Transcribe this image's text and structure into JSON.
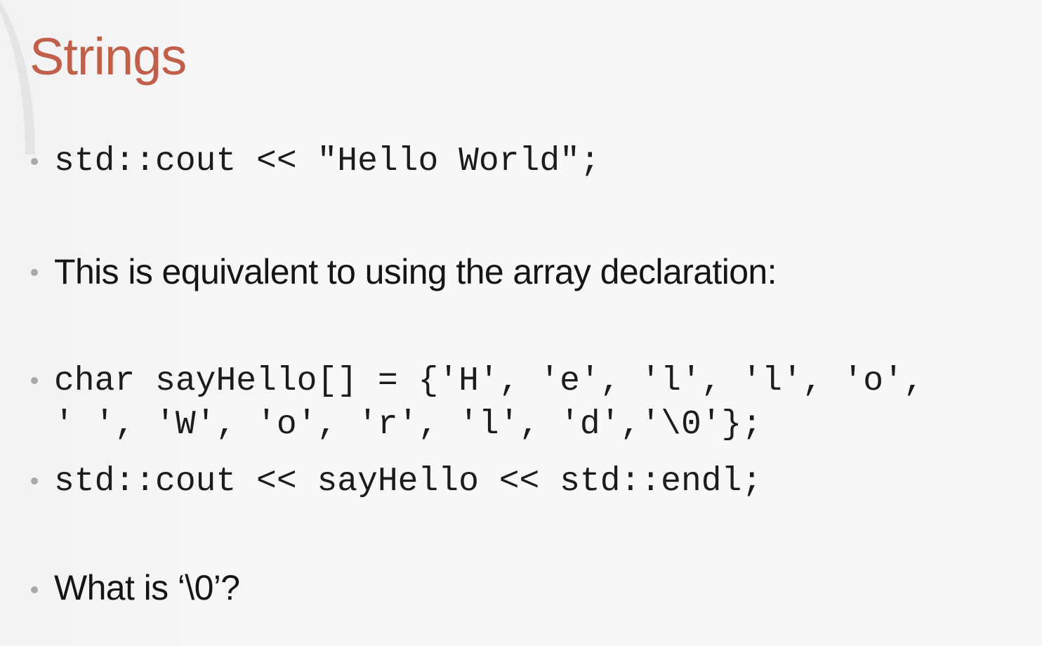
{
  "slide": {
    "title": "Strings",
    "bullets": [
      {
        "kind": "code",
        "lines": [
          "std::cout << \"Hello World\";"
        ]
      },
      {
        "kind": "text",
        "lines": [
          "This is equivalent to using the array declaration:"
        ]
      },
      {
        "kind": "code",
        "lines": [
          "char sayHello[] = {'H', 'e', 'l', 'l', 'o',",
          "' ', 'W', 'o', 'r', 'l', 'd','\\0'};"
        ]
      },
      {
        "kind": "code",
        "lines": [
          "std::cout << sayHello << std::endl;"
        ]
      },
      {
        "kind": "text",
        "lines": [
          "What is ‘\\0’?"
        ]
      }
    ]
  },
  "colors": {
    "title": "#c0604a",
    "text": "#151515",
    "bullet_dot": "#a9a9a9"
  }
}
